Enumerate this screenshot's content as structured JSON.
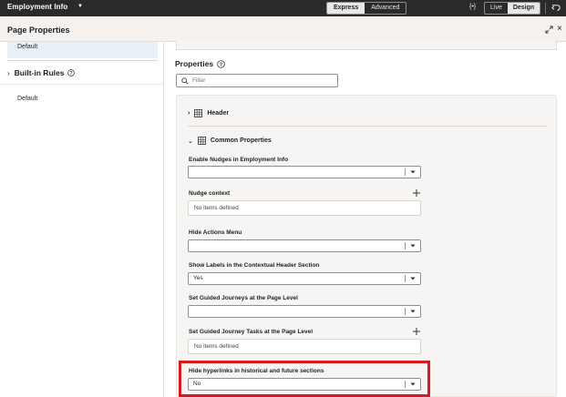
{
  "topbar": {
    "app_title": "Employment Info",
    "modes": [
      "Express",
      "Advanced"
    ],
    "active_mode": "Express",
    "code_toggle": "{•}",
    "views": [
      "Live",
      "Design"
    ],
    "active_view": "Design"
  },
  "page_properties": {
    "title": "Page Properties"
  },
  "left_panel": {
    "default_item": "Default",
    "builtin_rules_label": "Built-in Rules",
    "builtin_default_item": "Default"
  },
  "properties": {
    "title": "Properties",
    "filter_placeholder": "Filter",
    "header_section": "Header",
    "common_section": "Common Properties",
    "fields": {
      "enable_nudges": {
        "label": "Enable Nudges in Employment Info",
        "value": ""
      },
      "nudge_context": {
        "label": "Nudge context",
        "empty": "No items defined"
      },
      "hide_actions_menu": {
        "label": "Hide Actions Menu",
        "value": ""
      },
      "show_labels": {
        "label": "Show Labels in the Contextual Header Section",
        "value": "Yes"
      },
      "guided_journeys": {
        "label": "Set Guided Journeys at the Page Level",
        "value": ""
      },
      "guided_tasks": {
        "label": "Set Guided Journey Tasks at the Page Level",
        "empty": "No items defined"
      },
      "hide_hyperlinks": {
        "label": "Hide hyperlinks in historical and future sections",
        "value": "No"
      }
    }
  },
  "colors": {
    "topbar_bg": "#2a2a2a",
    "panel_bg": "#f7f5f3",
    "highlight": "#d71920",
    "selected_row": "#e9f1f8"
  }
}
